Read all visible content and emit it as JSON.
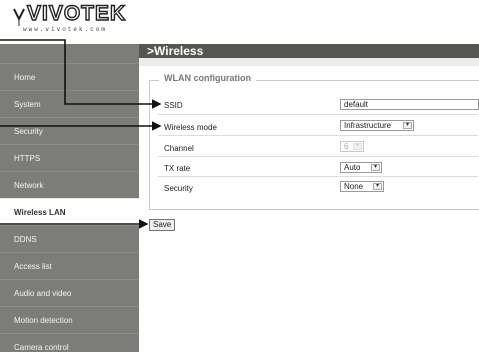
{
  "logo": {
    "brand": "VIVOTEK",
    "url": "www.vivotek.com"
  },
  "page_title": ">Wireless",
  "sidebar": {
    "items": [
      {
        "label": "Home"
      },
      {
        "label": "System"
      },
      {
        "label": "Security"
      },
      {
        "label": "HTTPS"
      },
      {
        "label": "Network"
      },
      {
        "label": "Wireless LAN",
        "active": true
      },
      {
        "label": "DDNS"
      },
      {
        "label": "Access list"
      },
      {
        "label": "Audio and video"
      },
      {
        "label": "Motion detection"
      },
      {
        "label": "Camera control"
      }
    ]
  },
  "wlan": {
    "legend": "WLAN configuration",
    "ssid": {
      "label": "SSID",
      "value": "default"
    },
    "mode": {
      "label": "Wireless mode",
      "value": "Infrastructure"
    },
    "channel": {
      "label": "Channel",
      "value": "6"
    },
    "txrate": {
      "label": "TX rate",
      "value": "Auto"
    },
    "security": {
      "label": "Security",
      "value": "None"
    }
  },
  "save_label": "Save",
  "icons": {
    "select_arrow": "chevron-down-icon"
  },
  "colors": {
    "sidebar": "#7c7d78",
    "titlebar": "#555652",
    "active_item": "#ffffff"
  }
}
